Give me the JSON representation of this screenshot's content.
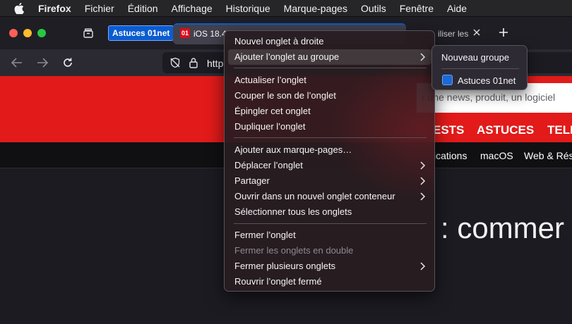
{
  "menubar": {
    "app": "Firefox",
    "items": [
      "Fichier",
      "Édition",
      "Affichage",
      "Historique",
      "Marque-pages",
      "Outils",
      "Fenêtre",
      "Aide"
    ]
  },
  "tabs": {
    "group_label": "Astuces 01net",
    "group_color": "#0b5cd0",
    "active_title": "iOS 18.4",
    "active_favicon": "01",
    "second_title": "iliser les",
    "new_tab_icon": "plus-icon",
    "close_icon": "close-icon"
  },
  "url": {
    "text": "http"
  },
  "page": {
    "search_placeholder": "r une news, produit, un logiciel",
    "nav_primary": [
      "ESTS",
      "ASTUCES",
      "TELE"
    ],
    "nav_secondary": [
      "ications",
      "macOS",
      "Web & Rés"
    ],
    "headline_fragment": ": commer",
    "brand_red": "#e21a1a"
  },
  "context_menu": {
    "items": [
      {
        "label": "Nouvel onglet à droite"
      },
      {
        "label": "Ajouter l’onglet au groupe",
        "submenu": true,
        "highlighted": true
      },
      {
        "label": "Actualiser l’onglet"
      },
      {
        "label": "Couper le son de l’onglet"
      },
      {
        "label": "Épingler cet onglet"
      },
      {
        "label": "Dupliquer l’onglet"
      },
      {
        "label": "Ajouter aux marque-pages…"
      },
      {
        "label": "Déplacer l’onglet",
        "submenu": true
      },
      {
        "label": "Partager",
        "submenu": true
      },
      {
        "label": "Ouvrir dans un nouvel onglet conteneur",
        "submenu": true
      },
      {
        "label": "Sélectionner tous les onglets"
      },
      {
        "label": "Fermer l’onglet"
      },
      {
        "label": "Fermer les onglets en double",
        "disabled": true
      },
      {
        "label": "Fermer plusieurs onglets",
        "submenu": true
      },
      {
        "label": "Rouvrir l’onglet fermé"
      }
    ]
  },
  "submenu": {
    "new_group": "Nouveau groupe",
    "group_name": "Astuces 01net",
    "group_color": "#1a6ad8"
  }
}
